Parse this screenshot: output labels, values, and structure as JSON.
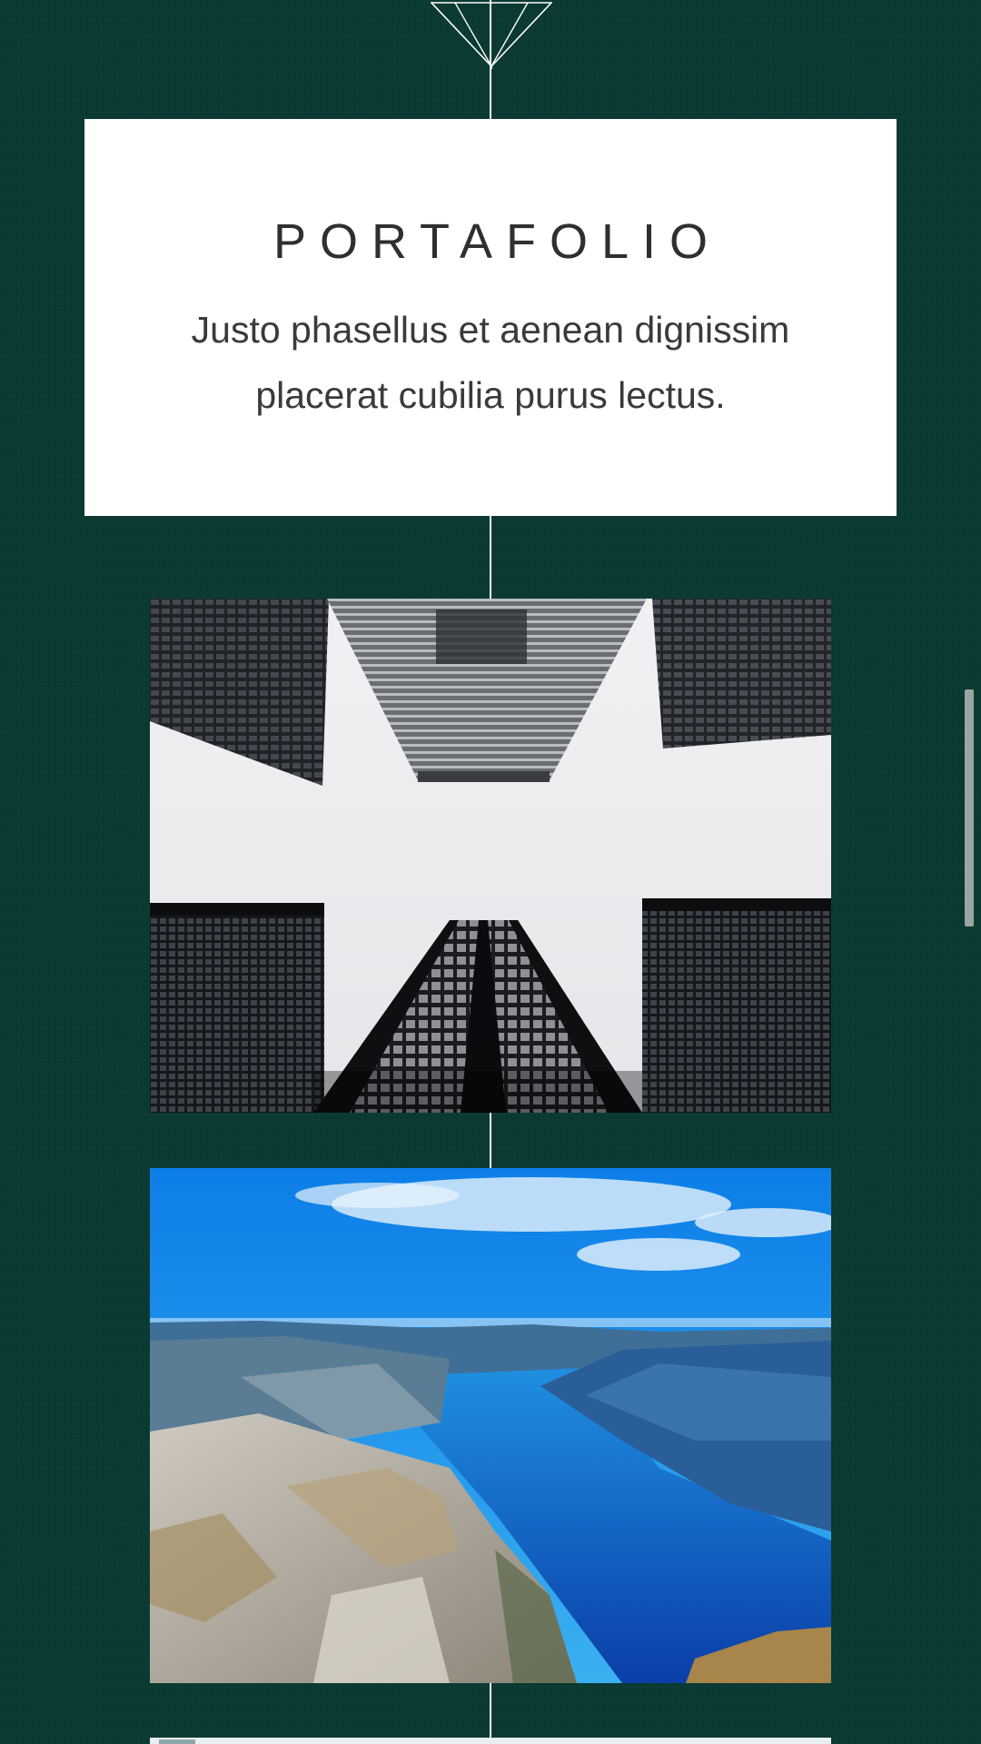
{
  "section": {
    "title": "PORTAFOLIO",
    "subtitle": "Justo phasellus et aenean dignissim placerat cubilia purus lectus."
  },
  "gallery": {
    "items": [
      {
        "icon": "skyscrapers-photo"
      },
      {
        "icon": "fjord-landscape-photo"
      },
      {
        "icon": "partial-photo"
      }
    ]
  },
  "colors": {
    "background": "#0b3a32",
    "card": "#ffffff",
    "line": "#ffffff",
    "title_text": "#2f2f2f"
  }
}
